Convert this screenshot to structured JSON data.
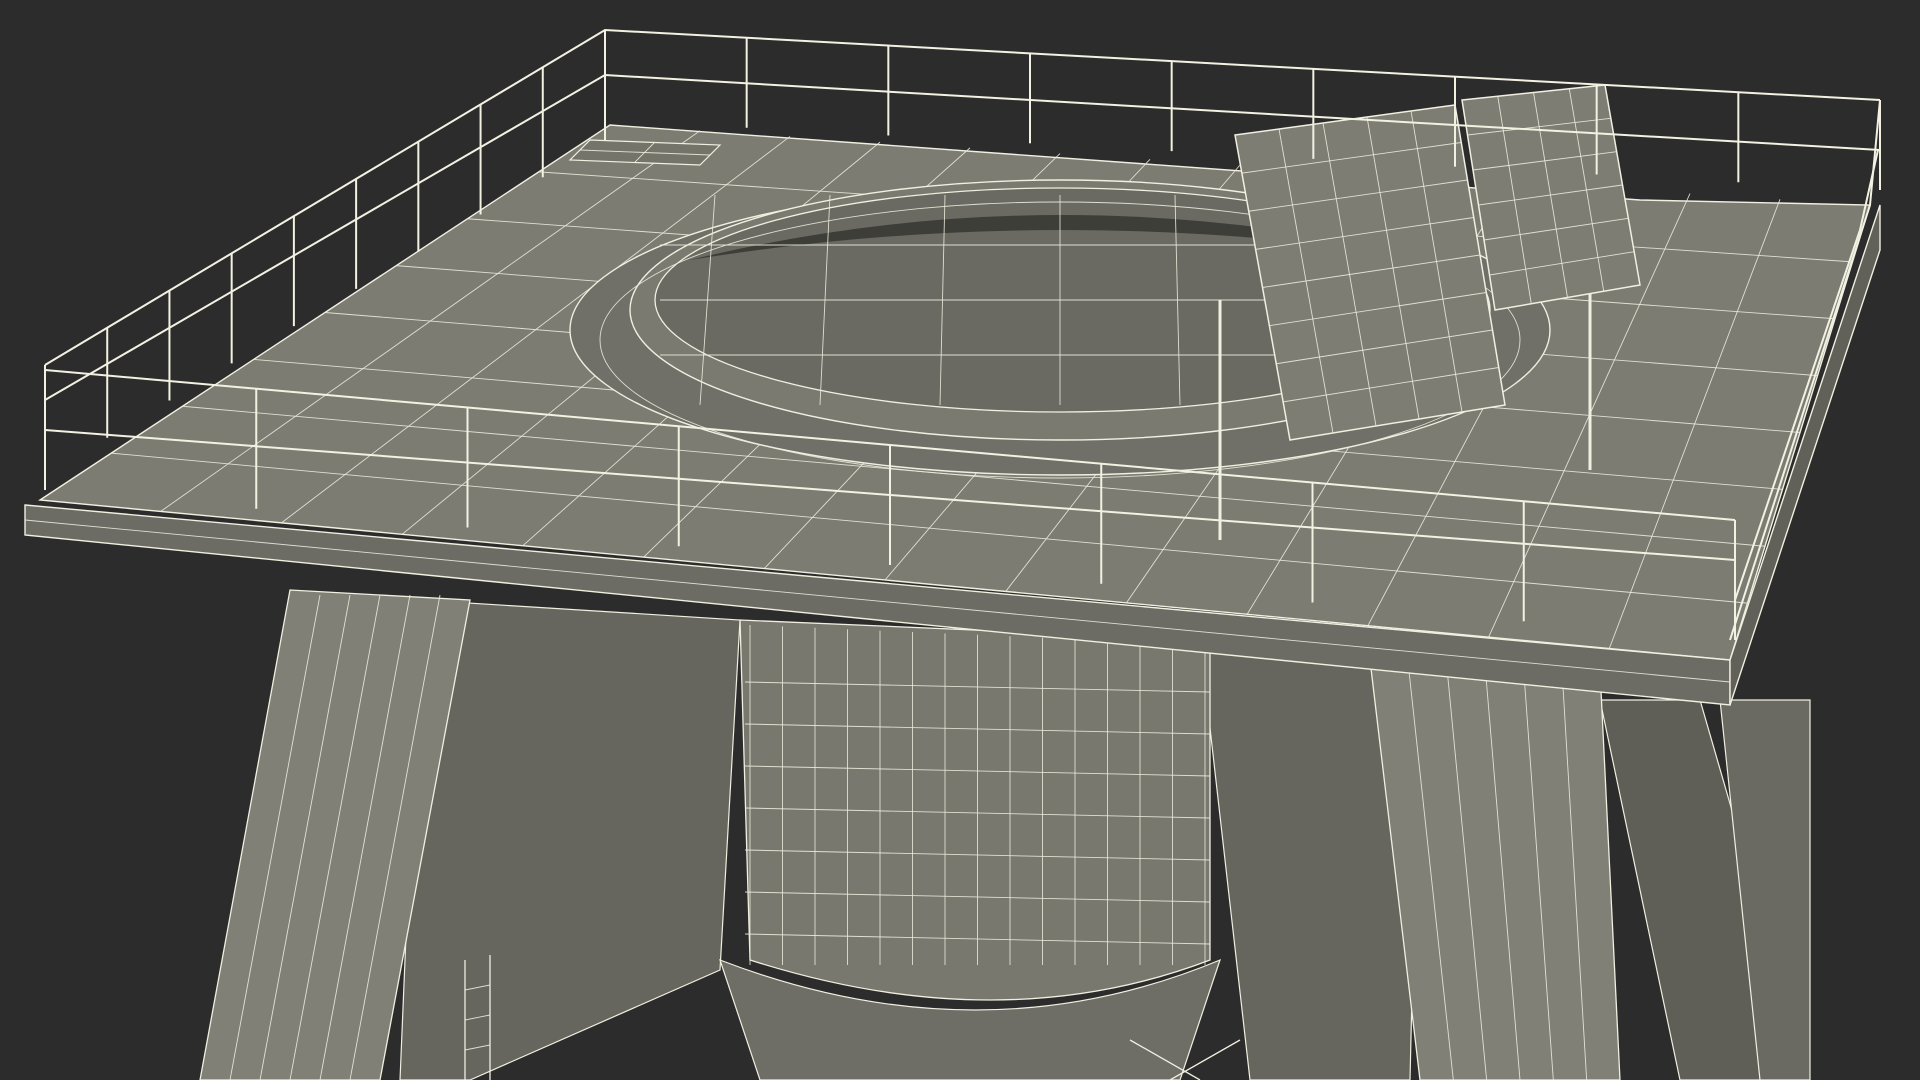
{
  "scene": {
    "background": "#2c2c2c",
    "surface_color": "#7a7a70",
    "surface_dark": "#5e5e56",
    "wire_color": "#f1efe0"
  },
  "elements": [
    "deck-platform",
    "helipad-ring",
    "safety-railing",
    "solar-panels",
    "support-legs",
    "central-tank",
    "hatch"
  ]
}
